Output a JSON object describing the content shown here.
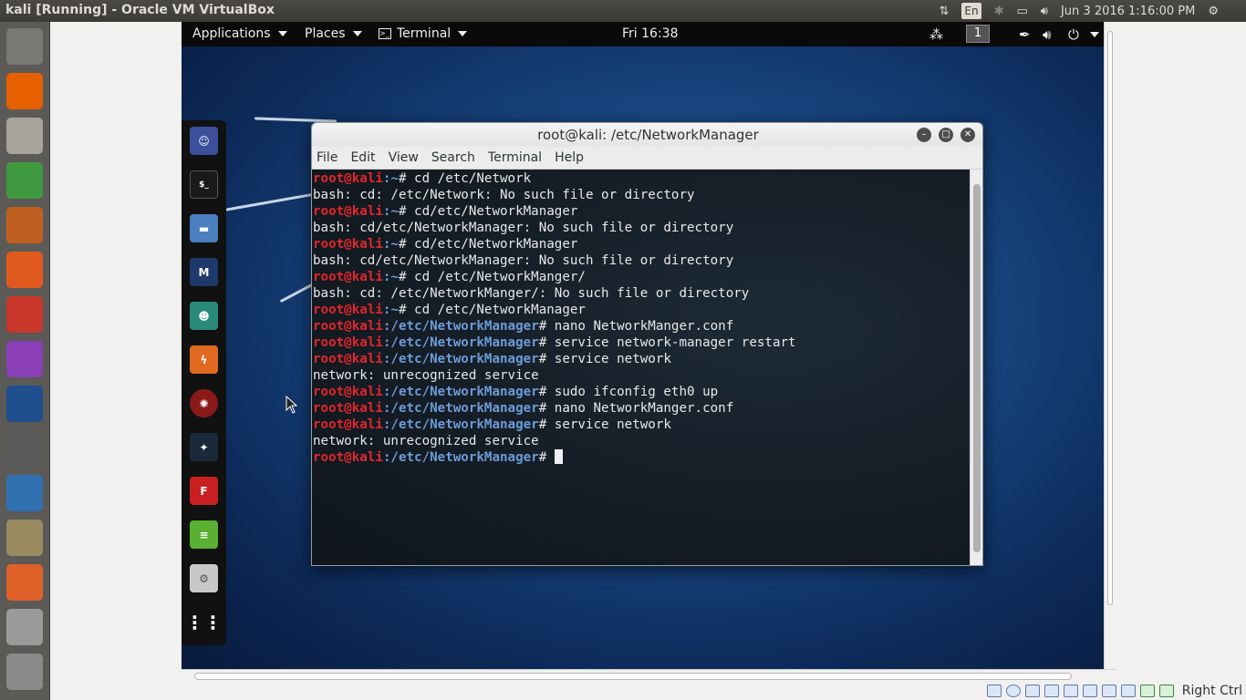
{
  "host_panel": {
    "title": "kali [Running] - Oracle VM VirtualBox",
    "keyboard_layout": "En",
    "datetime": "Jun 3 2016 1:16:00 PM"
  },
  "launcher": {
    "items": [
      {
        "name": "ubuntu-dash",
        "color": "#7a7873"
      },
      {
        "name": "firefox",
        "color": "#e66000"
      },
      {
        "name": "files",
        "color": "#a8a39c"
      },
      {
        "name": "libreoffice-calc",
        "color": "#3f9a3f"
      },
      {
        "name": "libreoffice-impress",
        "color": "#c06020"
      },
      {
        "name": "software-center",
        "color": "#e05a1e"
      },
      {
        "name": "system-settings",
        "color": "#c8372a"
      },
      {
        "name": "app-purple",
        "color": "#8a3fb8"
      },
      {
        "name": "oscilloscope",
        "color": "#1f4f8f"
      },
      {
        "name": "disk-utility",
        "color": "#5a5a5a"
      },
      {
        "name": "system-monitor",
        "color": "#3070b0"
      },
      {
        "name": "virtualbox-vm",
        "color": "#9a8a60"
      },
      {
        "name": "pdf-reader",
        "color": "#e0602a"
      },
      {
        "name": "drive",
        "color": "#9a9a9a"
      },
      {
        "name": "trash",
        "color": "#8a8a8a"
      }
    ]
  },
  "kali_bar": {
    "applications": "Applications",
    "places": "Places",
    "terminal": "Terminal",
    "clock": "Fri 16:38",
    "workspace": "1"
  },
  "terminal": {
    "title": "root@kali: /etc/NetworkManager",
    "menu": [
      "File",
      "Edit",
      "View",
      "Search",
      "Terminal",
      "Help"
    ],
    "lines": [
      {
        "user": "root@kali",
        "path": ":~",
        "cmd": "# cd /etc/Network"
      },
      {
        "text": "bash: cd: /etc/Network: No such file or directory"
      },
      {
        "user": "root@kali",
        "path": ":~",
        "cmd": "# cd/etc/NetworkManager"
      },
      {
        "text": "bash: cd/etc/NetworkManager: No such file or directory"
      },
      {
        "user": "root@kali",
        "path": ":~",
        "cmd": "# cd/etc/NetworkManager"
      },
      {
        "text": "bash: cd/etc/NetworkManager: No such file or directory"
      },
      {
        "user": "root@kali",
        "path": ":~",
        "cmd": "# cd /etc/NetworkManger/"
      },
      {
        "text": "bash: cd: /etc/NetworkManger/: No such file or directory"
      },
      {
        "user": "root@kali",
        "path": ":~",
        "cmd": "# cd /etc/NetworkManager"
      },
      {
        "user": "root@kali",
        "path": ":/etc/NetworkManager",
        "cmd": "# nano NetworkManger.conf"
      },
      {
        "user": "root@kali",
        "path": ":/etc/NetworkManager",
        "cmd": "# service network-manager restart"
      },
      {
        "user": "root@kali",
        "path": ":/etc/NetworkManager",
        "cmd": "# service network"
      },
      {
        "text": "network: unrecognized service"
      },
      {
        "user": "root@kali",
        "path": ":/etc/NetworkManager",
        "cmd": "# sudo ifconfig eth0 up"
      },
      {
        "user": "root@kali",
        "path": ":/etc/NetworkManager",
        "cmd": "# nano NetworkManger.conf"
      },
      {
        "user": "root@kali",
        "path": ":/etc/NetworkManager",
        "cmd": "# service network"
      },
      {
        "text": "network: unrecognized service"
      },
      {
        "user": "root@kali",
        "path": ":/etc/NetworkManager",
        "cmd": "# ",
        "cursor": true
      }
    ]
  },
  "vbox_status": {
    "host_key": "Right Ctrl"
  },
  "colors": {
    "prompt_user": "#e3262b",
    "prompt_path": "#6d9bd8"
  }
}
